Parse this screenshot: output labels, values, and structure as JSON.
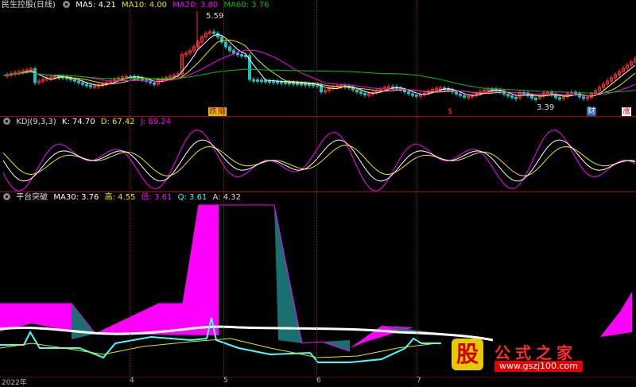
{
  "main": {
    "title": "民生控股(日线)",
    "ma5": "MA5: 4.21",
    "ma10": "MA10: 4.00",
    "ma20": "MA20: 3.80",
    "ma60": "MA60: 3.76",
    "high_label": "5.59",
    "low_label": "3.39",
    "flags": [
      "跌",
      "脑",
      "$",
      "财",
      "涨"
    ]
  },
  "kdj": {
    "title": "KDJ(9,3,3)",
    "k": "K: 74.70",
    "d": "D: 67.42",
    "j": "J: 89.24"
  },
  "platform": {
    "title": "平台突破",
    "ma30": "MA30: 3.76",
    "high": "高: 4.55",
    "low": "低: 3.61",
    "q": "Q: 3.61",
    "a": "A: 4.32"
  },
  "x_axis": [
    "2022年",
    "4",
    "5",
    "6",
    "7"
  ],
  "watermark": {
    "logo": "股",
    "title": "公式之家",
    "url": "www.gszj100.com"
  },
  "colors": {
    "up": "#ff3030",
    "down": "#20c0c0",
    "ma5": "#ffffff",
    "ma10": "#e8e800",
    "ma20": "#ff00ff",
    "ma60": "#00c000",
    "magenta": "#ff00ff",
    "teal": "#1a7070",
    "cyan": "#40ffff"
  }
}
